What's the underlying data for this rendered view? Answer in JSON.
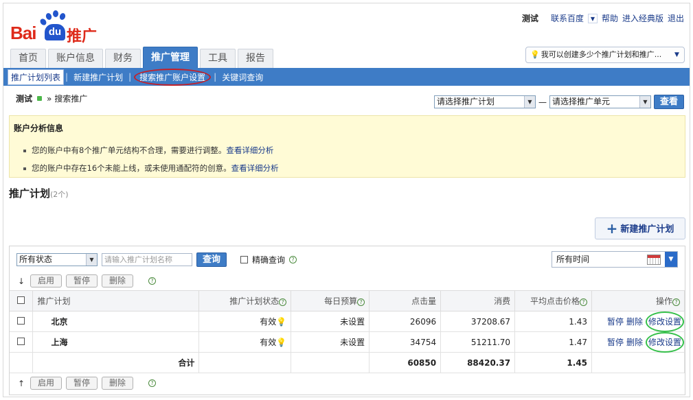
{
  "header": {
    "logo_text_bai": "Bai",
    "logo_text_du": "du",
    "logo_text_tg": "推广",
    "user": "测试",
    "links": [
      "联系百度",
      "帮助",
      "进入经典版",
      "退出"
    ]
  },
  "tabs": [
    {
      "label": "首页",
      "active": false
    },
    {
      "label": "账户信息",
      "active": false
    },
    {
      "label": "财务",
      "active": false
    },
    {
      "label": "推广管理",
      "active": true
    },
    {
      "label": "工具",
      "active": false
    },
    {
      "label": "报告",
      "active": false
    }
  ],
  "hint": {
    "text": "我可以创建多少个推广计划和推广...",
    "icon": "bulb-icon"
  },
  "subnav": [
    {
      "label": "推广计划列表",
      "active": true
    },
    {
      "label": "新建推广计划",
      "active": false
    },
    {
      "label": "搜索推广账户设置",
      "active": false,
      "circled": true
    },
    {
      "label": "关键词查询",
      "active": false
    }
  ],
  "crumb": {
    "user": "测试",
    "section": "搜索推广",
    "separator": "»"
  },
  "selectors": {
    "plan_placeholder": "请选择推广计划",
    "dash": "—",
    "unit_placeholder": "请选择推广单元",
    "button": "查看"
  },
  "analysis": {
    "title": "账户分析信息",
    "lines": [
      {
        "text": "您的账户中有8个推广单元结构不合理，需要进行调整。",
        "link": "查看详细分析"
      },
      {
        "text": "您的账户中存在16个未能上线，或未使用通配符的创意。",
        "link": "查看详细分析"
      }
    ]
  },
  "section": {
    "title": "推广计划",
    "count": "(2个)",
    "new_button": "新建推广计划"
  },
  "filter": {
    "status_value": "所有状态",
    "search_placeholder": "请输入推广计划名称",
    "search_button": "查询",
    "exact_label": "精确查询",
    "time_value": "所有时间"
  },
  "actions": {
    "enable": "启用",
    "pause": "暂停",
    "delete": "删除"
  },
  "table": {
    "headers": [
      "推广计划",
      "推广计划状态",
      "每日预算",
      "点击量",
      "消费",
      "平均点击价格",
      "操作"
    ],
    "rows": [
      {
        "name": "北京",
        "status": "有效",
        "budget": "未设置",
        "clicks": "26096",
        "cost": "37208.67",
        "avg": "1.43",
        "op_pause": "暂停",
        "op_delete": "删除",
        "op_edit": "修改设置"
      },
      {
        "name": "上海",
        "status": "有效",
        "budget": "未设置",
        "clicks": "34754",
        "cost": "51211.70",
        "avg": "1.47",
        "op_pause": "暂停",
        "op_delete": "删除",
        "op_edit": "修改设置"
      }
    ],
    "total": {
      "label": "合计",
      "clicks": "60850",
      "cost": "88420.37",
      "avg": "1.45"
    }
  }
}
